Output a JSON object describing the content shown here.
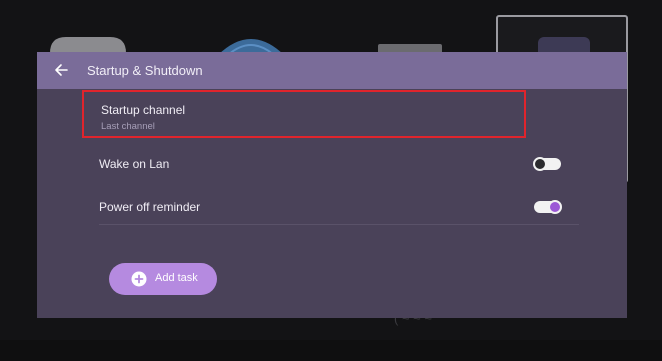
{
  "dialog": {
    "title": "Startup & Shutdown"
  },
  "settings": {
    "startup_channel": {
      "title": "Startup channel",
      "value": "Last channel"
    },
    "wake_on_lan": {
      "label": "Wake on Lan",
      "enabled": false
    },
    "power_off_reminder": {
      "label": "Power off reminder",
      "enabled": true
    }
  },
  "add_task": {
    "label": "Add task"
  },
  "colors": {
    "header": "#7a6c99",
    "panel": "#4a4259",
    "highlight": "#e0242c",
    "accent": "#9b58d6",
    "button": "#b58ae0"
  },
  "icons": {
    "back": "arrow-left-icon",
    "add": "plus-circle-icon"
  }
}
